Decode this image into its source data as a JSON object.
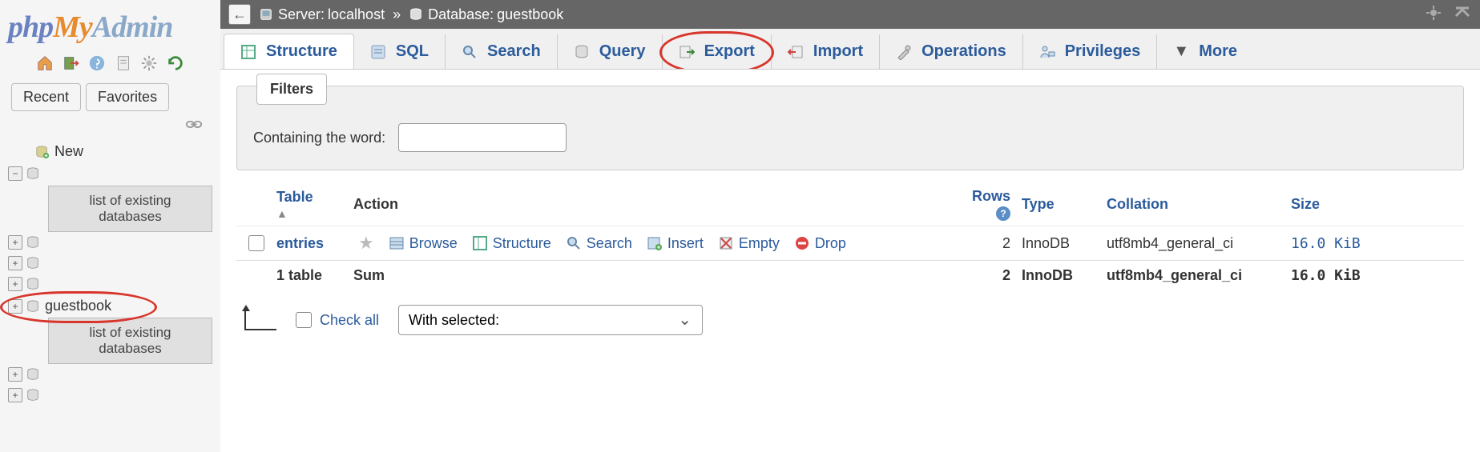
{
  "logo": {
    "p1": "php",
    "p2": "My",
    "p3": "Admin"
  },
  "sidebar": {
    "recent": "Recent",
    "favorites": "Favorites",
    "new": "New",
    "placeholder_text": "list of existing databases",
    "selected_db": "guestbook"
  },
  "breadcrumb": {
    "server_label": "Server:",
    "server_value": "localhost",
    "sep": "»",
    "db_label": "Database:",
    "db_value": "guestbook"
  },
  "tabs": {
    "structure": "Structure",
    "sql": "SQL",
    "search": "Search",
    "query": "Query",
    "export": "Export",
    "import": "Import",
    "operations": "Operations",
    "privileges": "Privileges",
    "more": "More"
  },
  "filters": {
    "title": "Filters",
    "label": "Containing the word:",
    "value": ""
  },
  "thead": {
    "table": "Table",
    "action": "Action",
    "rows": "Rows",
    "type": "Type",
    "collation": "Collation",
    "size": "Size"
  },
  "actions": {
    "browse": "Browse",
    "structure": "Structure",
    "search": "Search",
    "insert": "Insert",
    "empty": "Empty",
    "drop": "Drop"
  },
  "rows": [
    {
      "name": "entries",
      "rows": "2",
      "type": "InnoDB",
      "collation": "utf8mb4_general_ci",
      "size": "16.0 KiB"
    }
  ],
  "sum": {
    "count": "1 table",
    "label": "Sum",
    "rows": "2",
    "type": "InnoDB",
    "collation": "utf8mb4_general_ci",
    "size": "16.0 KiB"
  },
  "footer": {
    "checkall": "Check all",
    "with_selected": "With selected:"
  }
}
